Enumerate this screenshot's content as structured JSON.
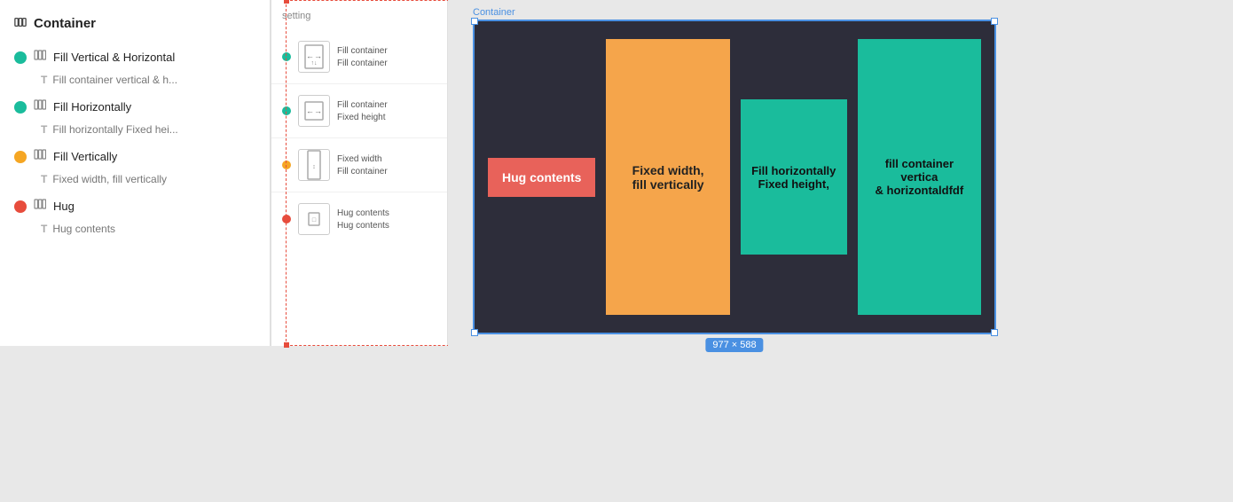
{
  "leftPanel": {
    "title": "Container",
    "items": [
      {
        "label": "Fill Vertical & Horizontal",
        "sublabel": "Fill container vertical & h...",
        "dotClass": "dot-green"
      },
      {
        "label": "Fill Horizontally",
        "sublabel": "Fill horizontally Fixed hei...",
        "dotClass": "dot-green"
      },
      {
        "label": "Fill Vertically",
        "sublabel": "Fixed width, fill vertically",
        "dotClass": "dot-orange"
      },
      {
        "label": "Hug",
        "sublabel": "Hug contents",
        "dotClass": "dot-red"
      }
    ]
  },
  "settingsPanel": {
    "title": "setting",
    "groups": [
      {
        "labels": [
          "Fill container",
          "Fill container"
        ]
      },
      {
        "labels": [
          "Fill container",
          "Fixed height"
        ]
      },
      {
        "labels": [
          "Fixed width",
          "Fill container"
        ]
      },
      {
        "labels": [
          "Hug contents",
          "Hug contents"
        ]
      }
    ]
  },
  "canvas": {
    "containerLabel": "Container",
    "sizeBadge": "977 × 588",
    "cards": {
      "hug": "Hug contents",
      "orange": "Fixed width,\nfill vertically",
      "tealSm": "Fill horizontally\nFixed height,",
      "tealLg": "fill container vertica\n& horizontaldfdf"
    }
  }
}
